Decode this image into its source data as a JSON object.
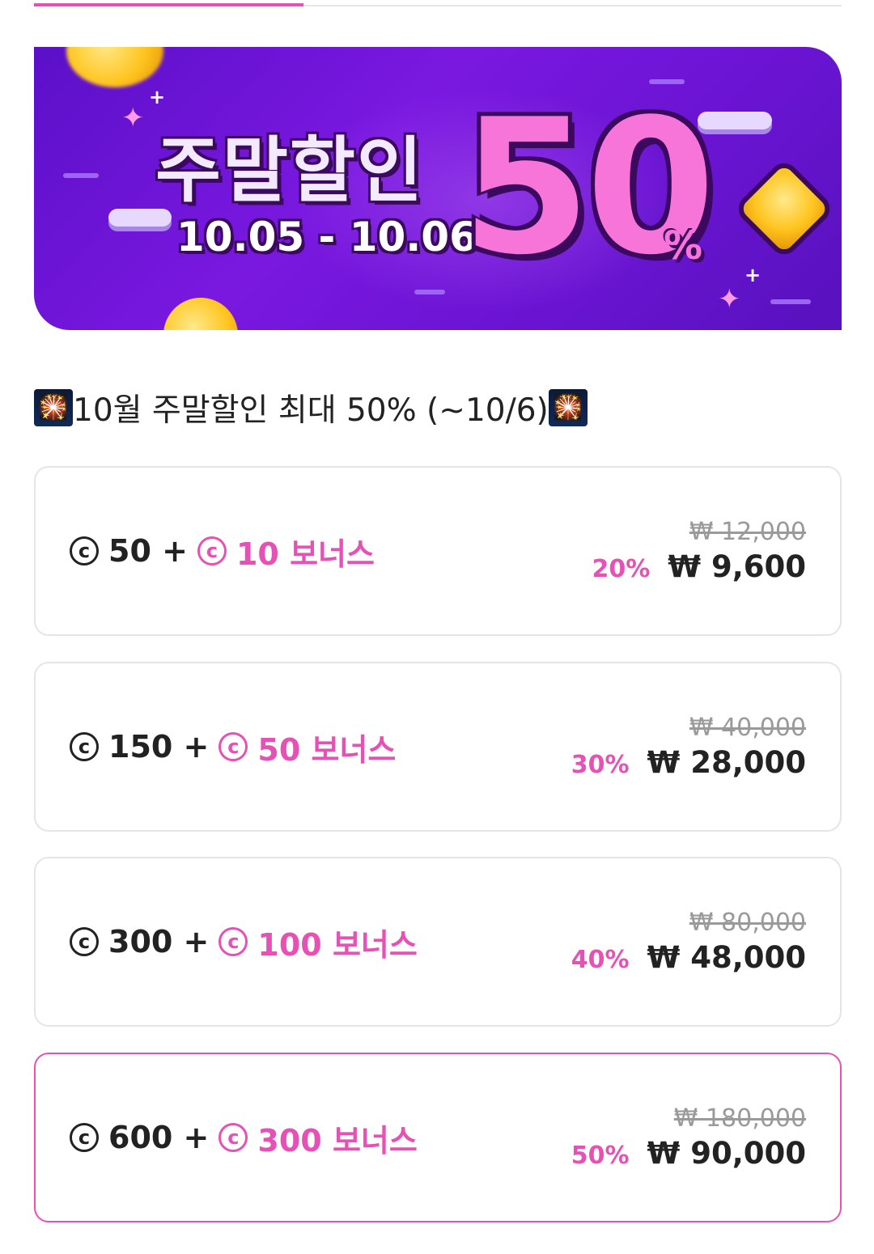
{
  "banner": {
    "title": "주말할인",
    "dates": "10.05 - 10.06",
    "big_number": "50",
    "percent_sign": "%"
  },
  "promo": {
    "title": "10월 주말할인 최대 50% (~10/6)",
    "emoji": "🎇"
  },
  "coin_symbol": "c",
  "packages": [
    {
      "base": "50 +",
      "bonus": "10 보너스",
      "original_price": "₩ 12,000",
      "discount": "20%",
      "price": "₩ 9,600",
      "selected": false
    },
    {
      "base": "150 +",
      "bonus": "50 보너스",
      "original_price": "₩ 40,000",
      "discount": "30%",
      "price": "₩ 28,000",
      "selected": false
    },
    {
      "base": "300 +",
      "bonus": "100 보너스",
      "original_price": "₩ 80,000",
      "discount": "40%",
      "price": "₩ 48,000",
      "selected": false
    },
    {
      "base": "600 +",
      "bonus": "300 보너스",
      "original_price": "₩ 180,000",
      "discount": "50%",
      "price": "₩ 90,000",
      "selected": true
    }
  ],
  "colors": {
    "accent": "#e651b5",
    "banner_purple": "#6a14d2",
    "text": "#222222",
    "muted": "#9a9a9a",
    "border": "#e5e5e5"
  }
}
